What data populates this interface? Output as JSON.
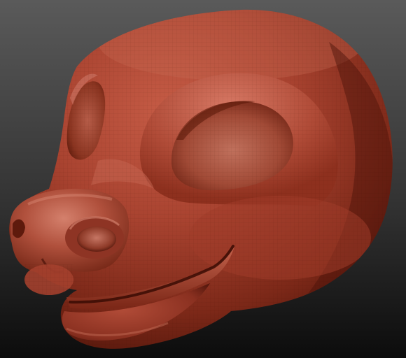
{
  "scene": {
    "subject": "sculpted-animal-head",
    "colors": {
      "background_top": "#5a5a5a",
      "background_bottom": "#0c0c0c",
      "clay_base": "#a53e2c",
      "clay_highlight": "#d8806a",
      "clay_shadow": "#4a1208",
      "clay_deep_shadow": "#2e0a04"
    }
  }
}
